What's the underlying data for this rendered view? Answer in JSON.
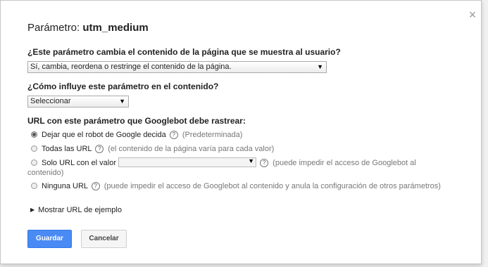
{
  "dialog": {
    "title_prefix": "Parámetro: ",
    "title_param": "utm_medium",
    "close_glyph": "×"
  },
  "question1": {
    "label": "¿Este parámetro cambia el contenido de la página que se muestra al usuario?",
    "selected": "Sí, cambia, reordena o restringe el contenido de la página."
  },
  "question2": {
    "label": "¿Cómo influye este parámetro en el contenido?",
    "selected": "Seleccionar"
  },
  "crawl": {
    "label": "URL con este parámetro que Googlebot debe rastrear:",
    "options": [
      {
        "label": "Dejar que el robot de Google decida",
        "hint": "(Predeterminada)",
        "checked": true
      },
      {
        "label": "Todas las URL",
        "hint": "(el contenido de la página varía para cada valor)",
        "checked": false
      },
      {
        "label": "Solo URL con el valor",
        "hint_line1": "(puede impedir el acceso de Googlebot al",
        "hint_line2": "contenido)",
        "checked": false
      },
      {
        "label": "Ninguna URL",
        "hint": "(puede impedir el acceso de Googlebot al contenido y anula la configuración de otros parámetros)",
        "checked": false
      }
    ]
  },
  "expander": {
    "label": "Mostrar URL de ejemplo"
  },
  "buttons": {
    "save": "Guardar",
    "cancel": "Cancelar"
  },
  "icons": {
    "help": "help-icon",
    "close": "close-icon",
    "dropdown": "chevron-down-icon",
    "expand": "triangle-right-icon"
  },
  "colors": {
    "primary_button": "#4a8af4",
    "hint_text": "#777777"
  }
}
